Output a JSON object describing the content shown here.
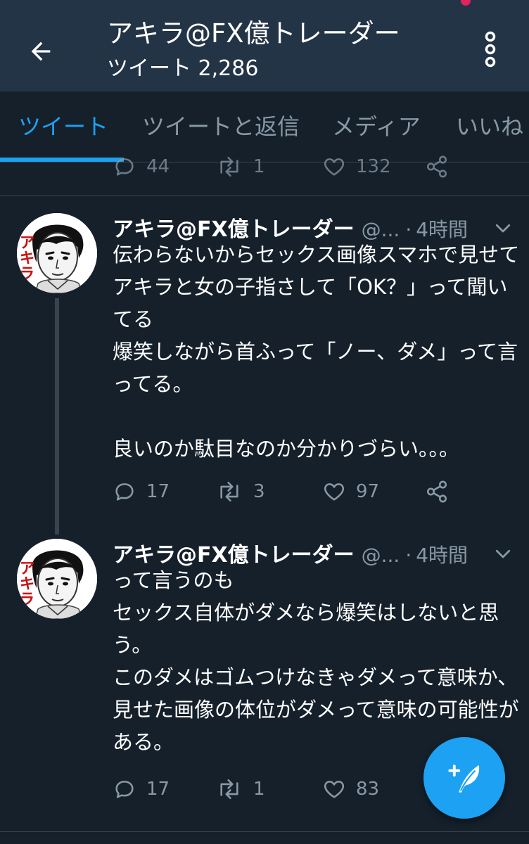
{
  "header": {
    "title": "アキラ@FX億トレーダー",
    "subtitle": "ツイート 2,286",
    "back_icon": "arrow-left-icon",
    "more_icon": "more-vertical-icon",
    "background": "#243447"
  },
  "tabs": [
    {
      "label": "ツイート",
      "active": true
    },
    {
      "label": "ツイートと返信",
      "active": false
    },
    {
      "label": "メディア",
      "active": false
    },
    {
      "label": "いいね",
      "active": false
    }
  ],
  "previous_tweet_actions": {
    "replies": "44",
    "retweets": "1",
    "likes": "132"
  },
  "tweets": [
    {
      "name": "アキラ@FX億トレーダー",
      "handle": "@...",
      "separator": "·",
      "time": "4時間",
      "text": "伝わらないからセックス画像スマホで見せてアキラと女の子指さして「OK？」って聞いてる\n爆笑しながら首ふって「ノー、ダメ」って言ってる。\n\n良いのか駄目なのか分かりづらい。。。",
      "replies": "17",
      "retweets": "3",
      "likes": "97"
    },
    {
      "name": "アキラ@FX億トレーダー",
      "handle": "@...",
      "separator": "·",
      "time": "4時間",
      "text": "って言うのも\nセックス自体がダメなら爆笑はしないと思う。\nこのダメはゴムつけなきゃダメって意味か、見せた画像の体位がダメって意味の可能性がある。",
      "replies": "17",
      "retweets": "1",
      "likes": "83"
    }
  ],
  "avatar_text": "アキラ",
  "fab_icon": "compose-tweet-icon",
  "colors": {
    "background": "#15202b",
    "accent": "#1da1f2",
    "muted": "#8899a6",
    "divider": "#38444d"
  }
}
